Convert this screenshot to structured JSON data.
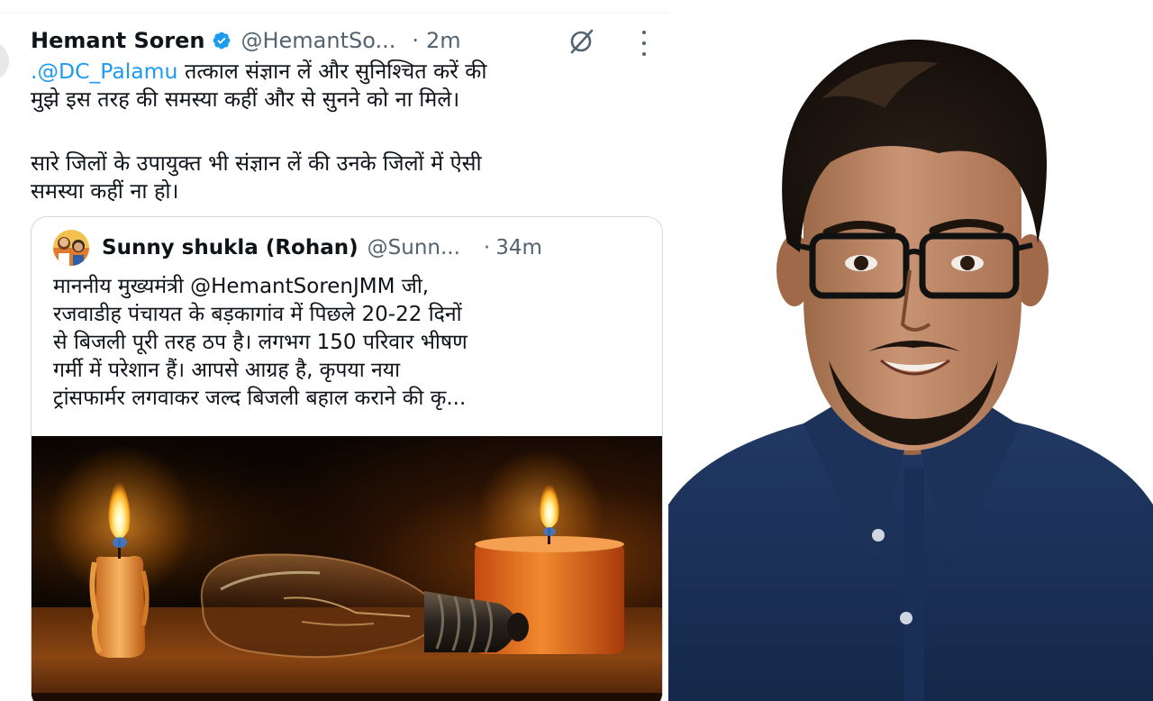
{
  "tweet": {
    "author_name": "Hemant Soren",
    "handle": "@HemantSo...",
    "dot": "·",
    "time": "2m",
    "icons": {
      "verified": "verified-badge-icon",
      "grok": "grok-icon",
      "more": "more-options-icon"
    },
    "mention": ".@DC_Palamu",
    "line1_rest": " तत्काल संज्ञान लें और सुनिश्चित करें की",
    "line2": "मुझे इस तरह की समस्या कहीं और से सुनने को ना मिले।",
    "para2_line1": "सारे जिलों के उपायुक्त भी संज्ञान लें  की उनके जिलों में ऐसी",
    "para2_line2": "समस्या कहीं ना हो।"
  },
  "quoted": {
    "author_name": "Sunny shukla (Rohan)",
    "handle": "@Sunn...",
    "dot": "·",
    "time": "34m",
    "lines": [
      "माननीय मुख्यमंत्री @HemantSorenJMM जी,",
      "रजवाडीह पंचायत के बड़कागांव में पिछले 20-22 दिनों",
      "से बिजली पूरी तरह ठप है। लगभग 150 परिवार भीषण",
      "गर्मी में परेशान हैं। आपसे आग्रह है, कृपया नया",
      "ट्रांसफार्मर लगवाकर जल्द बिजली बहाल कराने की कृ..."
    ],
    "media": "candles-and-light-bulb-photo"
  },
  "portrait": "man-with-glasses-portrait-photo",
  "colors": {
    "link": "#1d9bf0",
    "verified": "#1d9bf0",
    "muted": "#536471",
    "text": "#0f1419",
    "border": "#cfd9de"
  }
}
